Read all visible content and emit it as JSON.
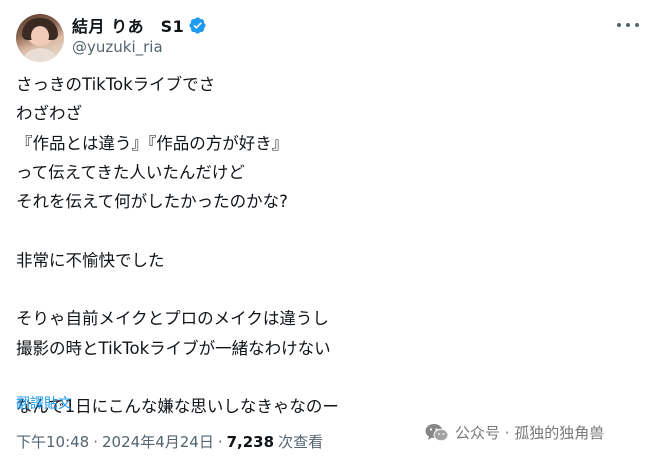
{
  "author": {
    "display_name": "結月 りあ　S1",
    "handle": "@yuzuki_ria",
    "verified": true
  },
  "icons": {
    "avatar": "avatar",
    "verified": "verified-badge-icon",
    "more": "more-options-icon",
    "watermark": "wechat-icon"
  },
  "tweet": {
    "text": "さっきのTikTokライブでさ\nわざわざ\n『作品とは違う』『作品の方が好き』\nって伝えてきた人いたんだけど\nそれを伝えて何がしたかったのかな?\n\n非常に不愉快でした\n\nそりゃ自前メイクとプロのメイクは違うし\n撮影の時とTikTokライブが一緒なわけない\n\nなんで1日にこんな嫌な思いしなきゃなのー",
    "translate_label": "翻譯貼文"
  },
  "meta": {
    "time": "下午10:48",
    "separator": "·",
    "date": "2024年4月24日",
    "views_count": "7,238",
    "views_label": "次查看"
  },
  "watermark": {
    "text": "公众号 · 孤独的独角兽"
  },
  "colors": {
    "text": "#0f1419",
    "secondary": "#536471",
    "link": "#1d9bf0",
    "verified": "#1d9bf0"
  }
}
